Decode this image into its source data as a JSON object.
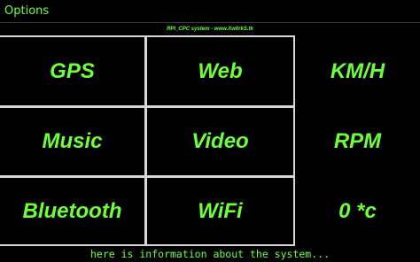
{
  "app": {
    "title": "Options",
    "subtitle": "RPI_CPC system - www.Xw0rkS.tk"
  },
  "grid": {
    "cells": [
      {
        "label": "GPS"
      },
      {
        "label": "Web"
      },
      {
        "label": "KM/H"
      },
      {
        "label": "Music"
      },
      {
        "label": "Video"
      },
      {
        "label": "RPM"
      },
      {
        "label": "Bluetooth"
      },
      {
        "label": "WiFi"
      },
      {
        "label": "0 *c"
      }
    ]
  },
  "status": {
    "text": "here is information about the system..."
  },
  "colors": {
    "text": "#6cff3a",
    "background": "#000000",
    "grid": "#d8d8d8"
  }
}
